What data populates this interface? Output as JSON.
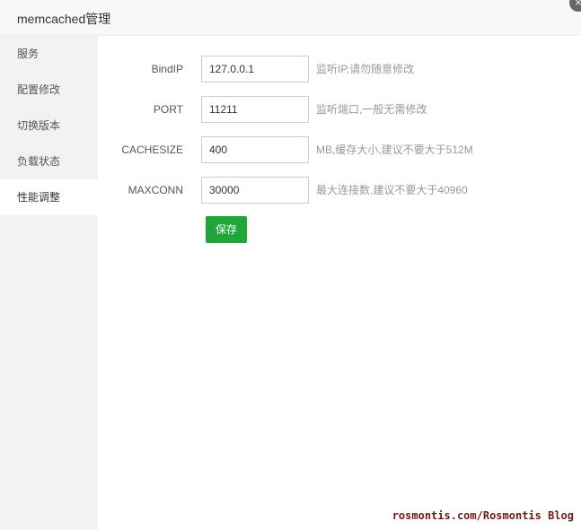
{
  "window": {
    "title": "memcached管理",
    "close_icon": "×"
  },
  "sidebar": {
    "items": [
      {
        "label": "服务"
      },
      {
        "label": "配置修改"
      },
      {
        "label": "切换版本"
      },
      {
        "label": "负载状态"
      },
      {
        "label": "性能调整",
        "active": true
      }
    ]
  },
  "form": {
    "fields": [
      {
        "label": "BindIP",
        "value": "127.0.0.1",
        "hint": "监听IP,请勿随意修改"
      },
      {
        "label": "PORT",
        "value": "11211",
        "hint": "监听端口,一般无需修改"
      },
      {
        "label": "CACHESIZE",
        "value": "400",
        "hint": "MB,缓存大小,建议不要大于512M"
      },
      {
        "label": "MAXCONN",
        "value": "30000",
        "hint": "最大连接数,建议不要大于40960"
      }
    ],
    "save_label": "保存"
  },
  "watermark": "rosmontis.com/Rosmontis Blog",
  "colors": {
    "accent": "#20a53a",
    "sidebar_bg": "#f2f2f2",
    "hint": "#999999"
  }
}
